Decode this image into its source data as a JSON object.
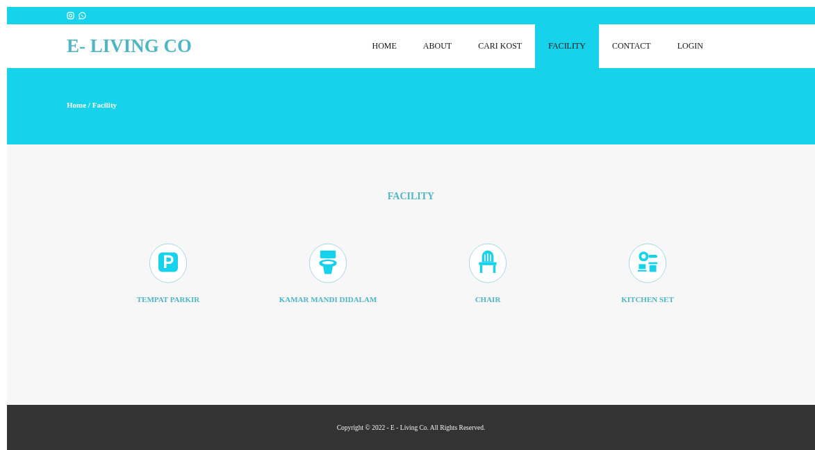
{
  "topbar": {
    "social": [
      {
        "kind": "instagram"
      },
      {
        "kind": "whatsapp"
      }
    ]
  },
  "header": {
    "logo": "E- LIVING CO",
    "nav": [
      {
        "label": "HOME",
        "selected": false
      },
      {
        "label": "ABOUT",
        "selected": false
      },
      {
        "label": "CARI KOST",
        "selected": false
      },
      {
        "label": "FACILITY",
        "selected": true
      },
      {
        "label": "CONTACT",
        "selected": false
      },
      {
        "label": "LOGIN",
        "selected": false
      }
    ]
  },
  "hero": {
    "breadcrumb": "Home / Facility"
  },
  "section": {
    "title": "FACILITY",
    "items": [
      {
        "kind": "parking",
        "label": "TEMPAT PARKIR"
      },
      {
        "kind": "toilet",
        "label": "KAMAR MANDI DIDALAM"
      },
      {
        "kind": "chair",
        "label": "CHAIR"
      },
      {
        "kind": "kitchen",
        "label": "KITCHEN SET"
      }
    ]
  },
  "footer": {
    "copyright": "Copyright © 2022 - E - Living Co. All Rights Reserved."
  }
}
